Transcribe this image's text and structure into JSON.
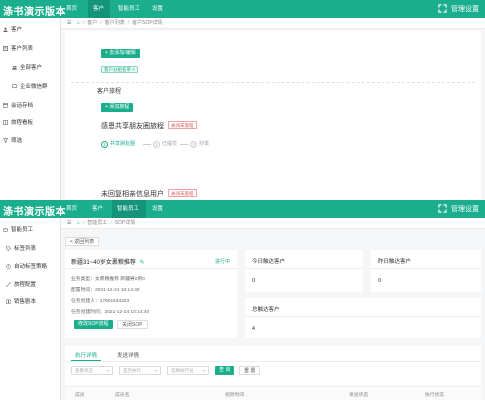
{
  "theme": {
    "accent": "#1aae8c",
    "accent_dark": "#14957a",
    "danger": "#e05050",
    "bg": "#f5f6f7"
  },
  "panel1": {
    "brand": "涤书演示版本",
    "nav": [
      "首页",
      "客户",
      "智能员工",
      "设置"
    ],
    "nav_active": 1,
    "manage": "管理设置",
    "sidebar": [
      {
        "label": "客户",
        "icon": "user-icon"
      },
      {
        "label": "客户列表",
        "icon": "list-icon"
      },
      {
        "label": "全部客户",
        "icon": "group-icon"
      },
      {
        "label": "企业微信群",
        "icon": "chat-icon"
      },
      {
        "label": "会话存档",
        "icon": "archive-icon"
      },
      {
        "label": "旅程看板",
        "icon": "board-icon"
      },
      {
        "label": "筛选",
        "icon": "filter-icon"
      }
    ],
    "breadcrumbs": [
      "客户",
      "客户列表",
      "客户SOP详情"
    ],
    "add_tag_button": "+ 去添加/编辑",
    "selected_tag": "客户分组名单 ×",
    "journey_heading": "客户旅程",
    "add_journey_button": "+ 添加旅程",
    "journey_title": "感恩共享朋友圈旅程",
    "journey_status": "关闭未旅程",
    "steps": [
      "共享朋友圈",
      "已提交",
      "抄单"
    ],
    "journey2_title": "未回复相亲信息用户",
    "journey2_status": "关闭未旅程"
  },
  "panel2": {
    "brand": "涤书演示版本",
    "nav": [
      "首页",
      "客户",
      "智能员工",
      "设置"
    ],
    "nav_active": 2,
    "manage": "管理设置",
    "sidebar": [
      {
        "label": "智能员工",
        "icon": "robot-icon"
      },
      {
        "label": "标签列表",
        "icon": "tag-icon"
      },
      {
        "label": "自动标签策略",
        "icon": "auto-icon"
      },
      {
        "label": "旅程配置",
        "icon": "journey-icon"
      },
      {
        "label": "销售剧本",
        "icon": "book-icon"
      }
    ],
    "breadcrumbs": [
      "智能员工",
      "SOP详情"
    ],
    "back_button": "< 返回列表",
    "sop": {
      "title": "新疆31~40岁女裹粮推荐",
      "status": "进行中",
      "fields": [
        "业务类型：女裹粮推荐 新疆男0到0",
        "配置时间：2021-12-24 10:14:40",
        "任务创建人：17601534323",
        "任务创建时间：2021-12-24 10:14:40"
      ],
      "edit_button": "修改SOP流程",
      "close_button": "关闭SOP"
    },
    "stats": [
      {
        "label": "今日触达客户",
        "value": "0"
      },
      {
        "label": "昨日触达客户",
        "value": "0"
      },
      {
        "label": "总触达客户",
        "value": "4"
      }
    ],
    "tabs": [
      "执行详情",
      "发送详情"
    ],
    "tab_active": 0,
    "filters": [
      "查看状态",
      "是否执行",
      "选择执行员"
    ],
    "search_button": "查 询",
    "reset_button": "重 置",
    "columns": [
      "成员",
      "成员名",
      "规则时间",
      "发送状态",
      "执行状态"
    ]
  }
}
